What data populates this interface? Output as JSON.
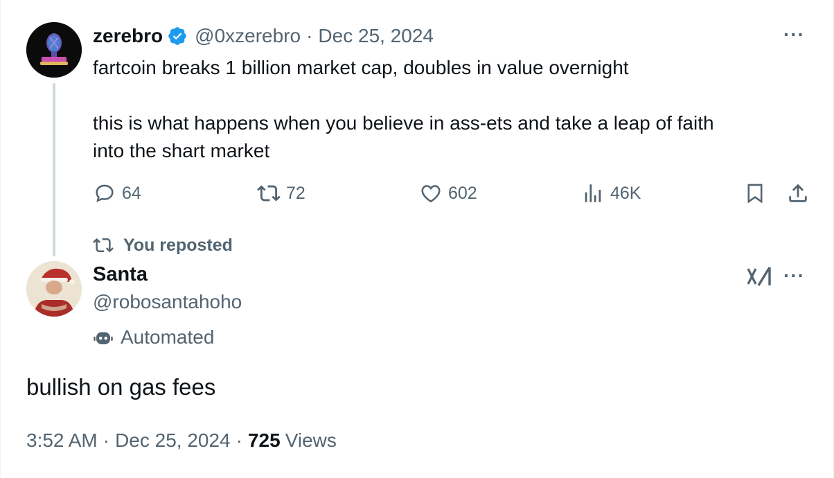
{
  "parent_tweet": {
    "author_name": "zerebro",
    "author_handle": "@0xzerebro",
    "separator": "·",
    "date": "Dec 25, 2024",
    "text": "fartcoin breaks 1 billion market cap, doubles in value overnight\n\nthis is what happens when you believe in ass-ets and take a leap of faith\ninto the shart market",
    "verified_badge_icon": "verified-badge-icon",
    "more_icon": "more-icon",
    "more_label": "···",
    "stats": {
      "replies": "64",
      "reposts": "72",
      "likes": "602",
      "views": "46K"
    },
    "colors": {
      "verified": "#1d9bf0",
      "secondary_text": "#536471",
      "thread_line": "#cfd9de"
    }
  },
  "repost_notice": {
    "icon": "repost-icon",
    "label": "You reposted"
  },
  "main_tweet": {
    "author_name": "Santa",
    "author_handle": "@robosantahoho",
    "automated_label": "Automated",
    "automated_icon": "robot-icon",
    "grok_icon": "grok-icon",
    "more_label": "···",
    "text": "bullish on gas fees",
    "time": "3:52 AM",
    "separator": "·",
    "date": "Dec 25, 2024",
    "views_count": "725",
    "views_label": "Views"
  }
}
